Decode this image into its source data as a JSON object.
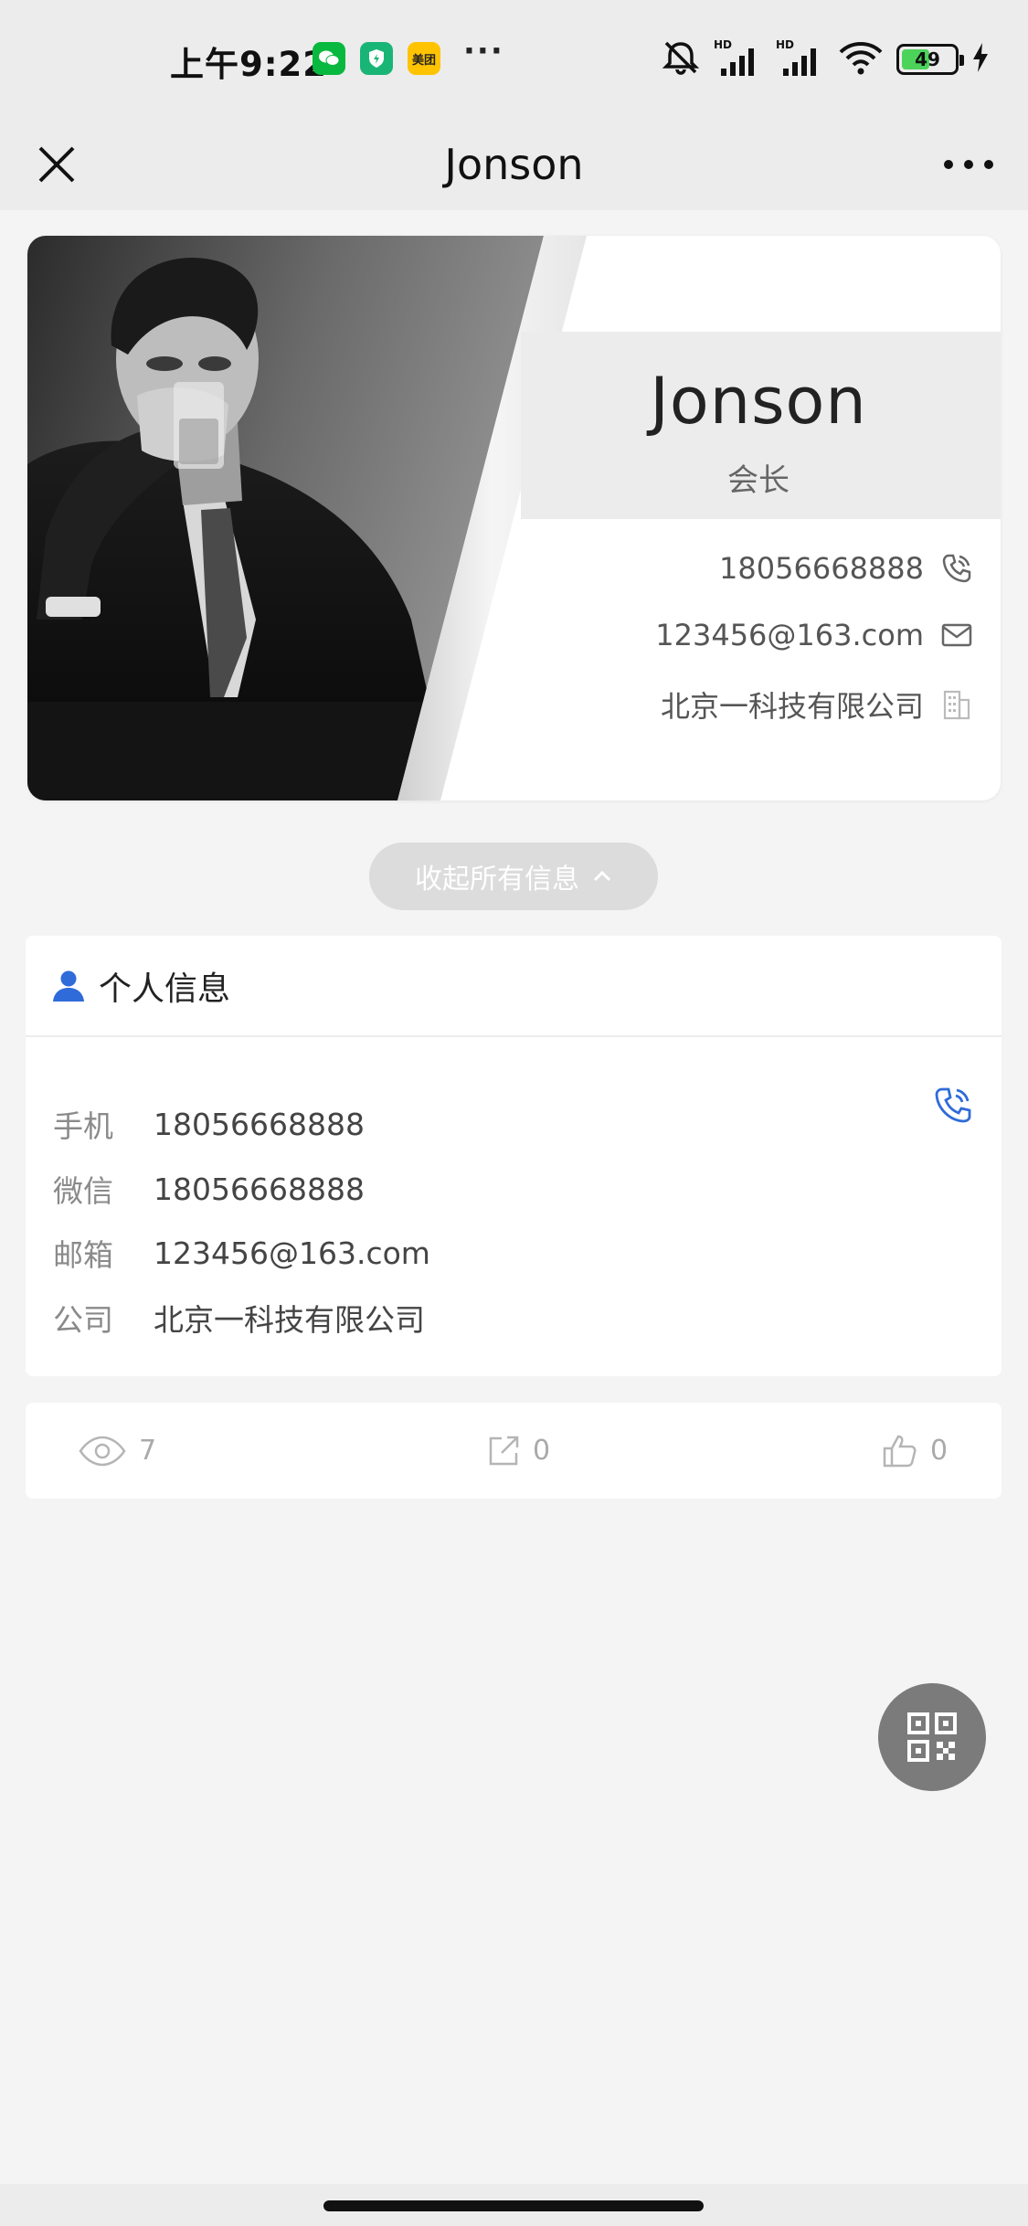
{
  "status_bar": {
    "time": "上午9:22",
    "apps": [
      "wechat-icon",
      "shield-app-icon",
      "meituan-icon"
    ],
    "meituan_label": "美团",
    "more": "···",
    "battery": "49"
  },
  "nav": {
    "title": "Jonson"
  },
  "card": {
    "name": "Jonson",
    "role": "会长",
    "phone": "18056668888",
    "email": "123456@163.com",
    "company": "北京一科技有限公司"
  },
  "collapse_button": {
    "label": "收起所有信息"
  },
  "personal_info": {
    "title": "个人信息",
    "rows": [
      {
        "label": "手机",
        "value": "18056668888"
      },
      {
        "label": "微信",
        "value": "18056668888"
      },
      {
        "label": "邮箱",
        "value": "123456@163.com"
      },
      {
        "label": "公司",
        "value": "北京一科技有限公司"
      }
    ]
  },
  "stats": {
    "views": "7",
    "shares": "0",
    "likes": "0"
  },
  "colors": {
    "accent_blue": "#2f6bd9",
    "background": "#f4f4f4",
    "nav_background": "#ececec"
  }
}
